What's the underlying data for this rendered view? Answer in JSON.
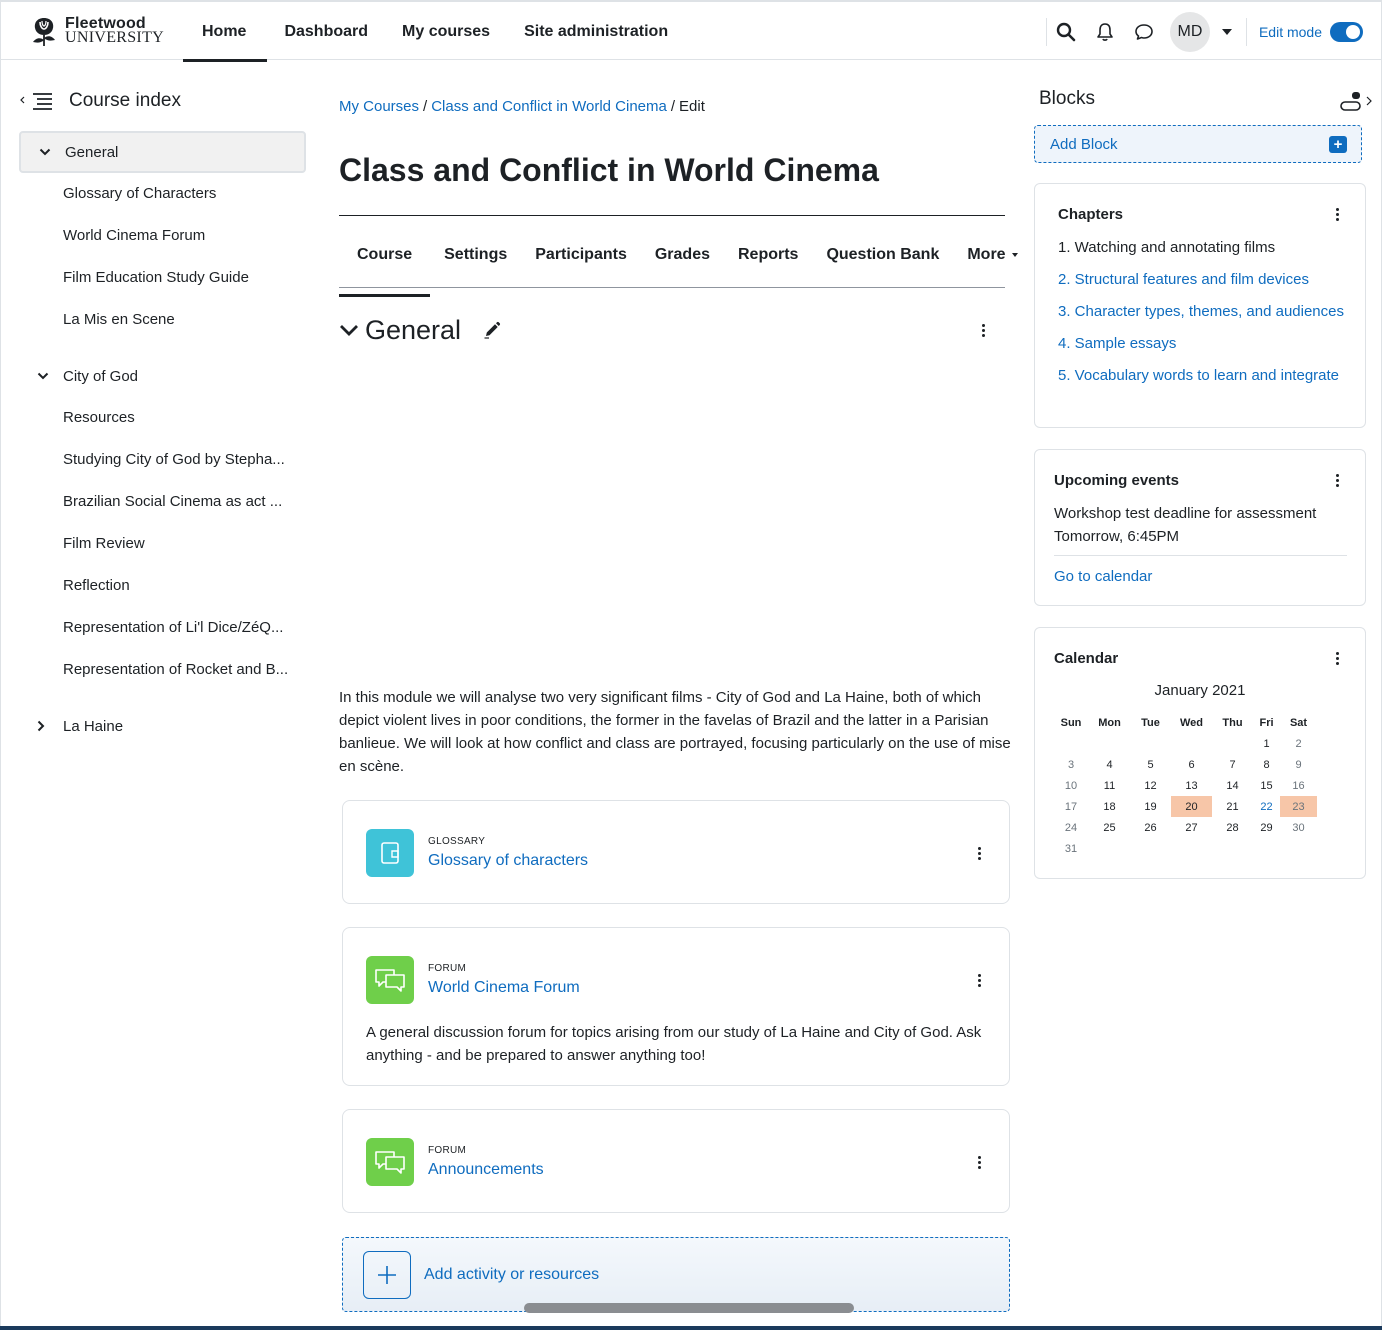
{
  "brand": {
    "line1": "Fleetwood",
    "line2": "UNIVERSITY"
  },
  "navbar": {
    "links": [
      "Home",
      "Dashboard",
      "My courses",
      "Site administration"
    ],
    "active": "Home",
    "avatar_initials": "MD",
    "edit_mode_label": "Edit mode",
    "edit_mode_on": true,
    "icons": [
      "search-icon",
      "bell-icon",
      "message-icon"
    ]
  },
  "course_index": {
    "title": "Course index",
    "sections": [
      {
        "label": "General",
        "expanded": true,
        "selected": true,
        "items": [
          "Glossary of Characters",
          "World Cinema Forum",
          "Film Education Study Guide",
          "La Mis en Scene"
        ]
      },
      {
        "label": "City of God",
        "expanded": true,
        "items": [
          "Resources",
          "Studying City of God by Stepha...",
          "Brazilian Social Cinema as act ...",
          "Film Review",
          "Reflection",
          "Representation of Li'l Dice/ZéQ...",
          "Representation of Rocket and B..."
        ]
      },
      {
        "label": "La Haine",
        "expanded": false,
        "items": []
      }
    ]
  },
  "breadcrumb": {
    "items": [
      "My Courses",
      "Class and Conflict in World Cinema"
    ],
    "current": "Edit"
  },
  "page_title": "Class and Conflict in World Cinema",
  "tabs": [
    "Course",
    "Settings",
    "Participants",
    "Grades",
    "Reports",
    "Question Bank",
    "More"
  ],
  "active_tab": "Course",
  "section": {
    "title": "General",
    "summary": "In this module we will analyse two very significant films - City of God and La Haine, both of which depict violent lives in poor conditions, the former in the favelas of Brazil and the latter in a Parisian banlieue. We will look at how conflict and class are portrayed, focusing particularly on the use of mise en scène."
  },
  "activities": [
    {
      "type": "GLOSSARY",
      "name": "Glossary of characters",
      "icon": "glossary-icon",
      "color": "#3fc3d8",
      "description": ""
    },
    {
      "type": "FORUM",
      "name": "World Cinema Forum",
      "icon": "forum-icon",
      "color": "#6fcf4a",
      "description": "A general discussion forum for topics arising from our study of La Haine and City of God. Ask anything - and be prepared to answer anything too!"
    },
    {
      "type": "FORUM",
      "name": "Announcements",
      "icon": "forum-icon",
      "color": "#6fcf4a",
      "description": ""
    }
  ],
  "add_activity_label": "Add activity or resources",
  "blocks": {
    "title": "Blocks",
    "add_block_label": "Add Block",
    "chapters": {
      "title": "Chapters",
      "items": [
        {
          "text": "1. Watching and annotating films",
          "current": true
        },
        {
          "text": "2. Structural features and film devices",
          "current": false
        },
        {
          "text": "3. Character types, themes, and audiences",
          "current": false
        },
        {
          "text": "4. Sample essays",
          "current": false
        },
        {
          "text": "5. Vocabulary words to learn and integrate",
          "current": false
        }
      ]
    },
    "upcoming": {
      "title": "Upcoming events",
      "event_name": "Workshop test deadline for assessment",
      "event_time": "Tomorrow, 6:45PM",
      "link": "Go to calendar"
    },
    "calendar": {
      "title": "Calendar",
      "month": "January 2021",
      "weekdays": [
        "Sun",
        "Mon",
        "Tue",
        "Wed",
        "Thu",
        "Fri",
        "Sat"
      ],
      "weeks": [
        [
          "",
          "",
          "",
          "",
          "",
          "1",
          "2"
        ],
        [
          "3",
          "4",
          "5",
          "6",
          "7",
          "8",
          "9"
        ],
        [
          "10",
          "11",
          "12",
          "13",
          "14",
          "15",
          "16"
        ],
        [
          "17",
          "18",
          "19",
          "20",
          "21",
          "22",
          "23"
        ],
        [
          "24",
          "25",
          "26",
          "27",
          "28",
          "29",
          "30"
        ],
        [
          "31",
          "",
          "",
          "",
          "",
          "",
          ""
        ]
      ],
      "highlighted": [
        "20",
        "23"
      ],
      "linked": [
        "22"
      ],
      "highlight_color": "#f7c6a8"
    }
  },
  "colors": {
    "link": "#0f6cbf",
    "text": "#1d2125",
    "border": "#dee2e6"
  }
}
